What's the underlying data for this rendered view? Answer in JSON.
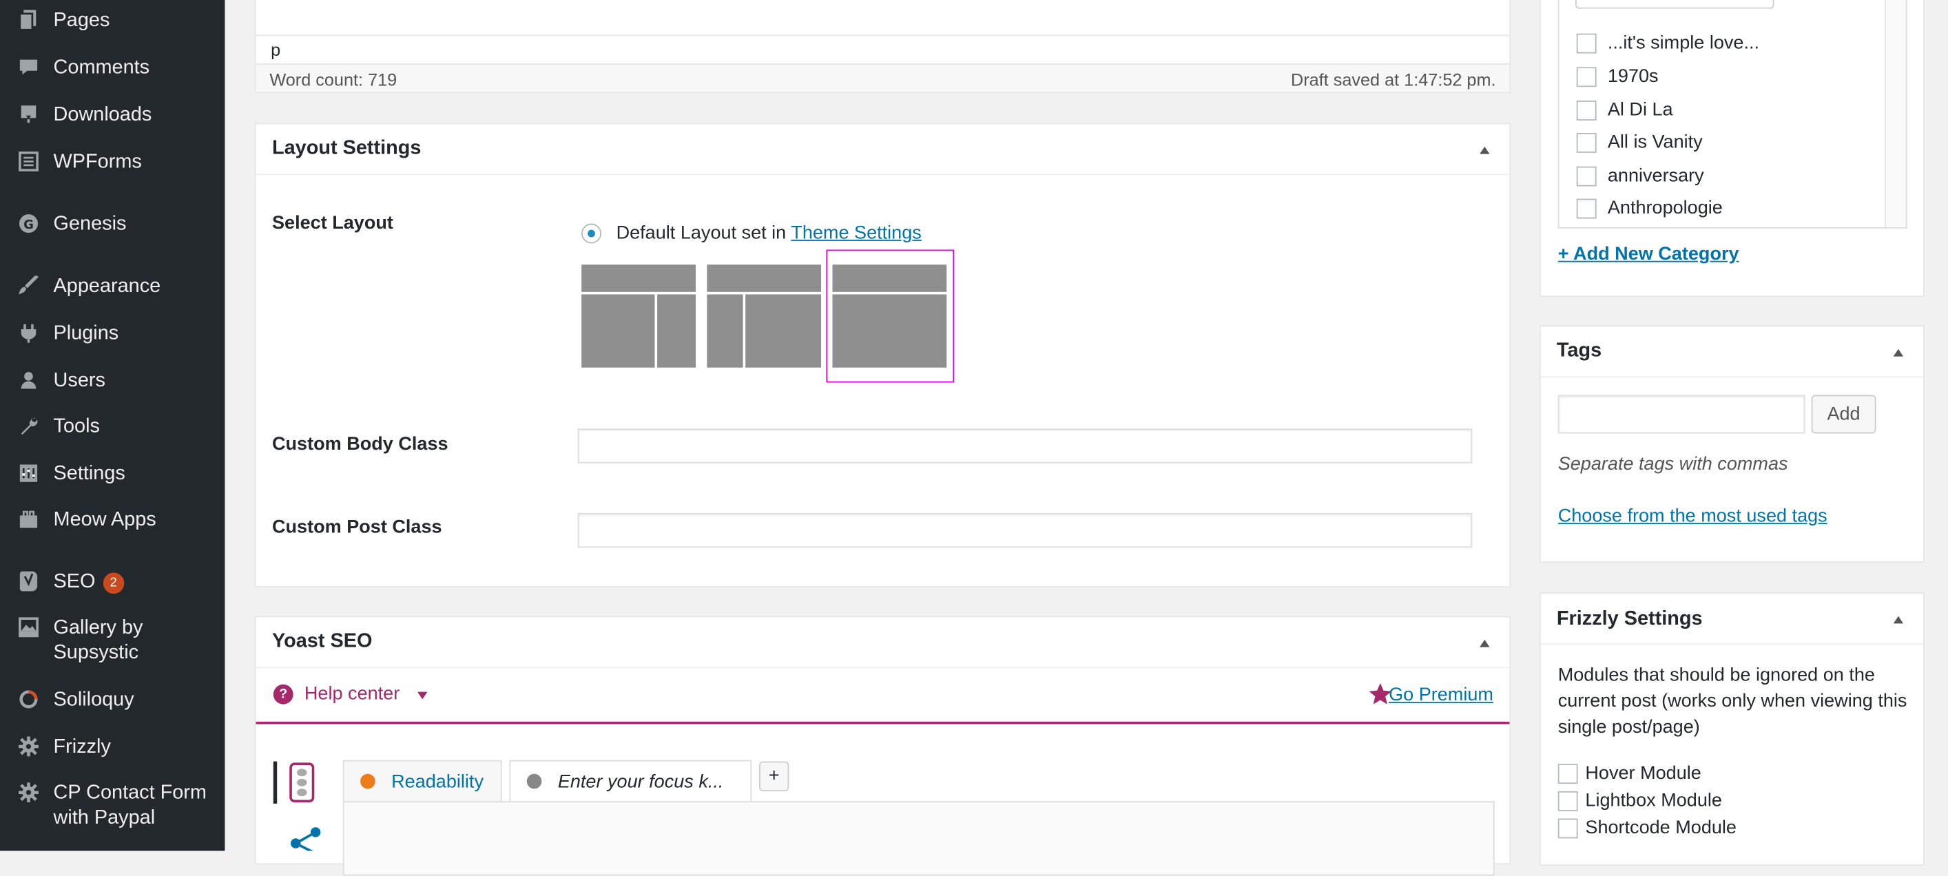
{
  "sidebar": {
    "items": [
      {
        "label": "Pages",
        "icon": "pages-icon"
      },
      {
        "label": "Comments",
        "icon": "comments-icon"
      },
      {
        "label": "Downloads",
        "icon": "downloads-icon"
      },
      {
        "label": "WPForms",
        "icon": "wpforms-icon"
      },
      {
        "label": "Genesis",
        "icon": "genesis-icon"
      },
      {
        "label": "Appearance",
        "icon": "appearance-icon"
      },
      {
        "label": "Plugins",
        "icon": "plugins-icon"
      },
      {
        "label": "Users",
        "icon": "users-icon"
      },
      {
        "label": "Tools",
        "icon": "tools-icon"
      },
      {
        "label": "Settings",
        "icon": "settings-icon"
      },
      {
        "label": "Meow Apps",
        "icon": "meow-apps-icon"
      },
      {
        "label": "SEO",
        "icon": "seo-icon",
        "badge": "2"
      },
      {
        "label": "Gallery by Supsystic",
        "icon": "gallery-icon"
      },
      {
        "label": "Soliloquy",
        "icon": "soliloquy-icon"
      },
      {
        "label": "Frizzly",
        "icon": "frizzly-icon"
      },
      {
        "label": "CP Contact Form with Paypal",
        "icon": "cp-contact-form-icon"
      }
    ]
  },
  "editor": {
    "path": "p",
    "word_count": "Word count: 719",
    "draft_saved": "Draft saved at 1:47:52 pm."
  },
  "layout_settings": {
    "title": "Layout Settings",
    "select_layout_label": "Select Layout",
    "default_layout_text": "Default Layout set in",
    "theme_settings_link": "Theme Settings",
    "custom_body_class_label": "Custom Body Class",
    "custom_body_class_value": "",
    "custom_post_class_label": "Custom Post Class",
    "custom_post_class_value": "",
    "layouts": [
      "content-sidebar",
      "sidebar-content",
      "full-width"
    ],
    "selected_layout": "full-width",
    "selected_border_color": "#e100e1"
  },
  "yoast": {
    "title": "Yoast SEO",
    "help_center": "Help center",
    "go_premium": "Go Premium",
    "tab_readability": "Readability",
    "tab_focus_placeholder": "Enter your focus k...",
    "add_tab": "+",
    "accent_color": "#a4286a"
  },
  "categories": {
    "items": [
      "...it's simple love...",
      "1970s",
      "Al Di La",
      "All is Vanity",
      "anniversary",
      "Anthropologie"
    ],
    "add_new": "+ Add New Category"
  },
  "tags": {
    "title": "Tags",
    "input_value": "",
    "add_button": "Add",
    "hint": "Separate tags with commas",
    "choose_link": "Choose from the most used tags"
  },
  "frizzly": {
    "title": "Frizzly Settings",
    "description": "Modules that should be ignored on the current post (works only when viewing this single post/page)",
    "modules": [
      "Hover Module",
      "Lightbox Module",
      "Shortcode Module"
    ]
  }
}
